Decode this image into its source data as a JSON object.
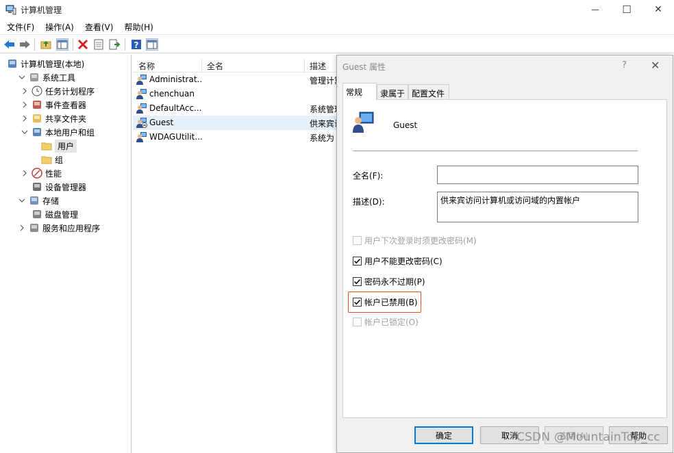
{
  "window": {
    "title": "计算机管理",
    "minimize_glyph": "—",
    "maximize_glyph": "☐",
    "close_glyph": "✕"
  },
  "menu": [
    "文件(F)",
    "操作(A)",
    "查看(V)",
    "帮助(H)"
  ],
  "toolbar": {
    "icons": [
      "back-arrow-icon",
      "forward-arrow-icon",
      "up-folder-icon",
      "show-tree-icon",
      "delete-icon",
      "properties-icon",
      "export-list-icon",
      "help-icon",
      "action-pane-icon"
    ]
  },
  "tree": {
    "items": [
      {
        "label": "计算机管理(本地)",
        "icon": "computer-management-icon",
        "level": 0,
        "expander": ""
      },
      {
        "label": "系统工具",
        "icon": "tools-icon",
        "level": 1,
        "expander": "expanded"
      },
      {
        "label": "任务计划程序",
        "icon": "clock-icon",
        "level": 2,
        "expander": "collapsed"
      },
      {
        "label": "事件查看器",
        "icon": "event-viewer-icon",
        "level": 2,
        "expander": "collapsed"
      },
      {
        "label": "共享文件夹",
        "icon": "shared-folder-icon",
        "level": 2,
        "expander": "collapsed"
      },
      {
        "label": "本地用户和组",
        "icon": "users-group-icon",
        "level": 2,
        "expander": "expanded"
      },
      {
        "label": "用户",
        "icon": "folder-icon",
        "level": 3,
        "expander": "",
        "selected": true
      },
      {
        "label": "组",
        "icon": "folder-icon",
        "level": 3,
        "expander": ""
      },
      {
        "label": "性能",
        "icon": "performance-icon",
        "level": 2,
        "expander": "collapsed"
      },
      {
        "label": "设备管理器",
        "icon": "device-manager-icon",
        "level": 2,
        "expander": ""
      },
      {
        "label": "存储",
        "icon": "storage-icon",
        "level": 1,
        "expander": "expanded"
      },
      {
        "label": "磁盘管理",
        "icon": "disk-icon",
        "level": 2,
        "expander": ""
      },
      {
        "label": "服务和应用程序",
        "icon": "services-icon",
        "level": 1,
        "expander": "collapsed"
      }
    ]
  },
  "list": {
    "columns": [
      "名称",
      "全名",
      "描述"
    ],
    "rows": [
      {
        "name": "Administrat...",
        "desc": "管理计算",
        "icon": "user-icon"
      },
      {
        "name": "chenchuan",
        "desc": "",
        "icon": "user-icon"
      },
      {
        "name": "DefaultAcc...",
        "desc": "系统管理",
        "icon": "user-icon"
      },
      {
        "name": "Guest",
        "desc": "供来宾访",
        "icon": "user-disabled-icon",
        "selected": true
      },
      {
        "name": "WDAGUtilit...",
        "desc": "系统为",
        "icon": "user-icon"
      }
    ]
  },
  "dialog": {
    "title": "Guest 属性",
    "help_glyph": "?",
    "close_glyph": "✕",
    "tabs": [
      "常规",
      "隶属于",
      "配置文件"
    ],
    "active_tab": 0,
    "user_name": "Guest",
    "fullname_label": "全名(F):",
    "fullname_value": "",
    "desc_label": "描述(D):",
    "desc_value": "供来宾访问计算机或访问域的内置帐户",
    "checkboxes": [
      {
        "label": "用户下次登录时须更改密码(M)",
        "checked": false,
        "disabled": true
      },
      {
        "label": "用户不能更改密码(C)",
        "checked": true,
        "disabled": false
      },
      {
        "label": "密码永不过期(P)",
        "checked": true,
        "disabled": false
      },
      {
        "label": "帐户已禁用(B)",
        "checked": true,
        "disabled": false,
        "highlighted": true
      },
      {
        "label": "帐户已锁定(O)",
        "checked": false,
        "disabled": true
      }
    ],
    "buttons": {
      "ok": "确定",
      "cancel": "取消",
      "apply": "应用(A)",
      "help": "帮助"
    },
    "highlight_color": "#d9531e"
  },
  "watermark": "CSDN @MountainTop_cc"
}
